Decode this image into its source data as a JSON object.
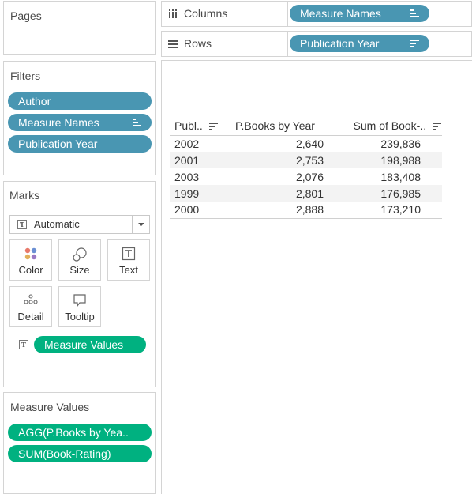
{
  "pages": {
    "title": "Pages"
  },
  "filters": {
    "title": "Filters",
    "pills": [
      "Author",
      "Measure Names",
      "Publication Year"
    ]
  },
  "marks": {
    "title": "Marks",
    "mark_type": "Automatic",
    "cards": {
      "color": "Color",
      "size": "Size",
      "text": "Text",
      "detail": "Detail",
      "tooltip": "Tooltip"
    },
    "text_pill": "Measure Values",
    "text_glyph": "T"
  },
  "measure_values": {
    "title": "Measure Values",
    "pills": [
      "AGG(P.Books by Yea..",
      "SUM(Book-Rating)"
    ]
  },
  "columns_shelf": {
    "label": "Columns",
    "pill": "Measure Names"
  },
  "rows_shelf": {
    "label": "Rows",
    "pill": "Publication Year"
  },
  "view": {
    "headers": [
      "Publ..",
      "P.Books by Year",
      "Sum of Book-.."
    ],
    "rows": [
      [
        "2002",
        "2,640",
        "239,836"
      ],
      [
        "2001",
        "2,753",
        "198,988"
      ],
      [
        "2003",
        "2,076",
        "183,408"
      ],
      [
        "1999",
        "2,801",
        "176,985"
      ],
      [
        "2000",
        "2,888",
        "173,210"
      ]
    ]
  },
  "colors": {
    "dimension_pill": "#4996b2",
    "measure_pill": "#00b180",
    "border": "#d4d4d4",
    "band": "#f3f3f3"
  }
}
